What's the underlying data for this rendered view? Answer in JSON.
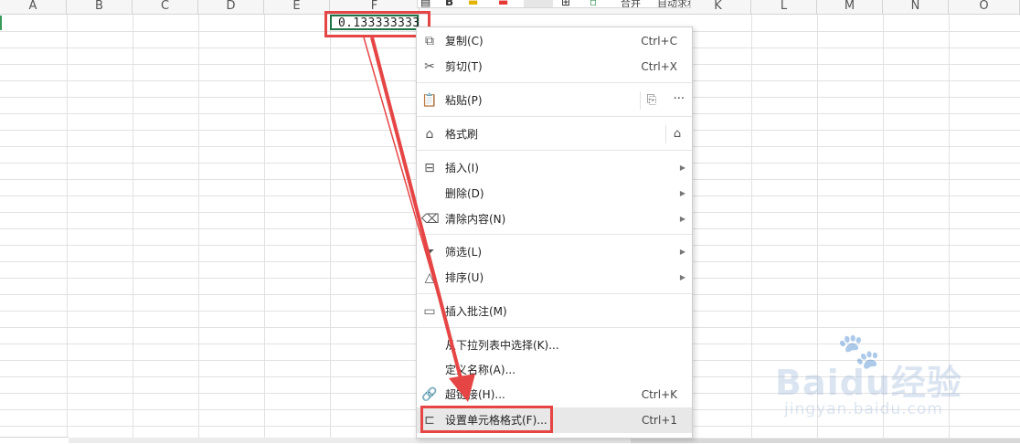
{
  "columns": [
    "A",
    "B",
    "C",
    "D",
    "E",
    "F",
    "",
    "",
    "",
    "K",
    "L",
    "M",
    "N",
    "O"
  ],
  "cell": {
    "value": "0.133333333"
  },
  "mini_toolbar": {
    "text1": "合并",
    "text2": "自动求和"
  },
  "menu": {
    "copy": {
      "label": "复制(C)",
      "shortcut": "Ctrl+C"
    },
    "cut": {
      "label": "剪切(T)",
      "shortcut": "Ctrl+X"
    },
    "paste": {
      "label": "粘贴(P)",
      "more": "···"
    },
    "format_painter": {
      "label": "格式刷"
    },
    "insert": {
      "label": "插入(I)"
    },
    "delete": {
      "label": "删除(D)"
    },
    "clear": {
      "label": "清除内容(N)"
    },
    "filter": {
      "label": "筛选(L)"
    },
    "sort": {
      "label": "排序(U)"
    },
    "comment": {
      "label": "插入批注(M)"
    },
    "pick_list": {
      "label": "从下拉列表中选择(K)..."
    },
    "define_name": {
      "label": "定义名称(A)..."
    },
    "hyperlink": {
      "label": "超链接(H)...",
      "shortcut": "Ctrl+K"
    },
    "format_cells": {
      "label": "设置单元格格式(F)...",
      "shortcut": "Ctrl+1"
    }
  },
  "watermark": {
    "brand": "Baidu经验",
    "url": "jingyan.baidu.com"
  },
  "colors": {
    "highlight": "#e64545",
    "active_border": "#217346"
  }
}
